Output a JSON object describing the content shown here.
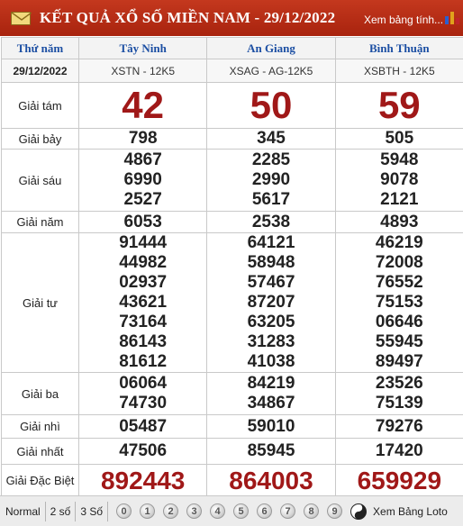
{
  "header": {
    "title": "KẾT QUẢ XỔ SỐ MIỀN NAM - 29/12/2022",
    "link_label": "Xem bảng tính..."
  },
  "table": {
    "header_label": "Thứ năm",
    "date": "29/12/2022",
    "provinces": [
      {
        "name": "Tây Ninh",
        "code": "XSTN - 12K5"
      },
      {
        "name": "An Giang",
        "code": "XSAG - AG-12K5"
      },
      {
        "name": "Bình Thuận",
        "code": "XSBTH - 12K5"
      }
    ],
    "prizes": [
      {
        "label": "Giải tám",
        "values": [
          [
            "42"
          ],
          [
            "50"
          ],
          [
            "59"
          ]
        ]
      },
      {
        "label": "Giải bảy",
        "values": [
          [
            "798"
          ],
          [
            "345"
          ],
          [
            "505"
          ]
        ]
      },
      {
        "label": "Giải sáu",
        "values": [
          [
            "4867",
            "6990",
            "2527"
          ],
          [
            "2285",
            "2990",
            "5617"
          ],
          [
            "5948",
            "9078",
            "2121"
          ]
        ]
      },
      {
        "label": "Giải năm",
        "values": [
          [
            "6053"
          ],
          [
            "2538"
          ],
          [
            "4893"
          ]
        ]
      },
      {
        "label": "Giải tư",
        "values": [
          [
            "91444",
            "44982",
            "02937",
            "43621",
            "73164",
            "86143",
            "81612"
          ],
          [
            "64121",
            "58948",
            "57467",
            "87207",
            "63205",
            "31283",
            "41038"
          ],
          [
            "46219",
            "72008",
            "76552",
            "75153",
            "06646",
            "55945",
            "89497"
          ]
        ]
      },
      {
        "label": "Giải ba",
        "values": [
          [
            "06064",
            "74730"
          ],
          [
            "84219",
            "34867"
          ],
          [
            "23526",
            "75139"
          ]
        ]
      },
      {
        "label": "Giải nhì",
        "values": [
          [
            "05487"
          ],
          [
            "59010"
          ],
          [
            "79276"
          ]
        ]
      },
      {
        "label": "Giải nhất",
        "values": [
          [
            "47506"
          ],
          [
            "85945"
          ],
          [
            "17420"
          ]
        ]
      },
      {
        "label": "Giải Đặc Biệt",
        "values": [
          [
            "892443"
          ],
          [
            "864003"
          ],
          [
            "659929"
          ]
        ]
      }
    ]
  },
  "footer": {
    "modes": [
      "Normal",
      "2 số",
      "3 Số"
    ],
    "digits": [
      "0",
      "1",
      "2",
      "3",
      "4",
      "5",
      "6",
      "7",
      "8",
      "9"
    ],
    "link_label": "Xem Bảng Loto"
  },
  "colors": {
    "header_bg": "#b52d15",
    "province_text": "#1c4fa3",
    "highlight_number": "#a01818"
  },
  "icons": [
    "mail-icon",
    "chart-icon",
    "yin-yang-icon"
  ]
}
